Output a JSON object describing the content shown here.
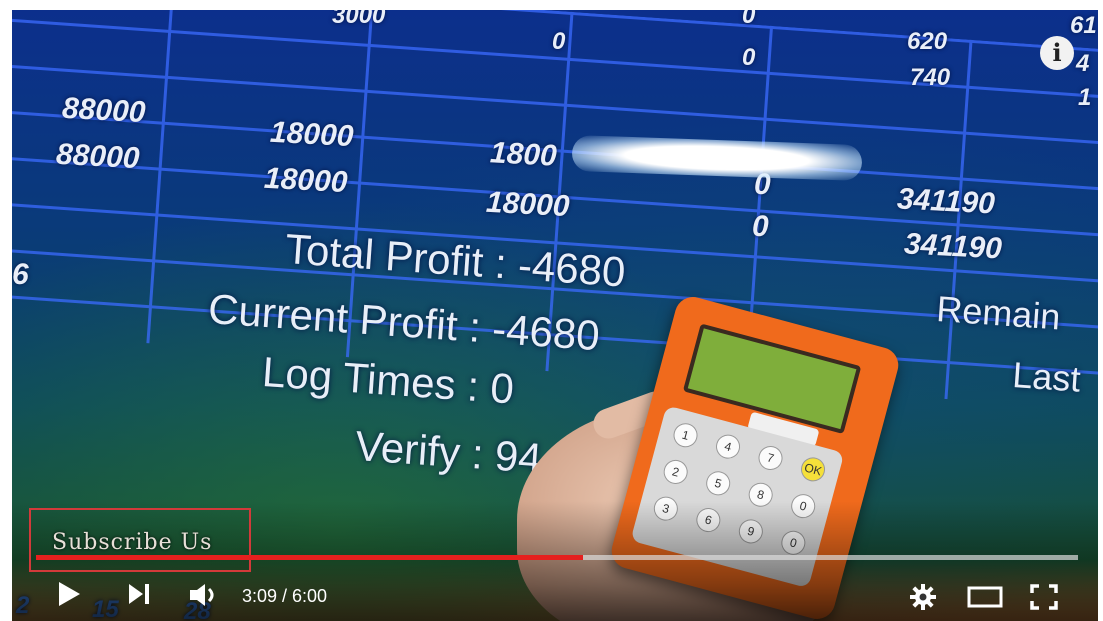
{
  "video": {
    "table_top": {
      "r1": [
        "3000",
        "0",
        "0",
        "620",
        "61"
      ],
      "r2": [
        "0",
        "740",
        "4"
      ],
      "r3": [
        "1"
      ]
    },
    "rows": [
      [
        "88000",
        "18000",
        "1800",
        "",
        "341190"
      ],
      [
        "88000",
        "18000",
        "18000",
        "0",
        "341190"
      ]
    ],
    "extra_zero": "0",
    "left_digit": "6",
    "labels": {
      "total_profit": "Total Profit : -4680",
      "current_profit": "Current Profit : -4680",
      "log_times": "Log Times : 0",
      "verify": "Verify : 94",
      "remain": "Remain",
      "last": "Last"
    },
    "bottom_numbers": [
      "2",
      "15",
      "28"
    ],
    "keypad_keys": [
      "1",
      "2",
      "3",
      "4",
      "5",
      "6",
      "7",
      "8",
      "9",
      "0",
      "0",
      "OK"
    ]
  },
  "overlay": {
    "subscribe_text": "Subscribe Us",
    "info_icon": "i"
  },
  "player": {
    "current_time": "3:09",
    "duration": "6:00",
    "time_display": "3:09 / 6:00",
    "progress_fraction": 0.525,
    "colors": {
      "progress": "#e5201e",
      "overlay_box": "#d23a3a"
    },
    "icons": [
      "play-icon",
      "next-icon",
      "volume-icon",
      "settings-icon",
      "theater-icon",
      "fullscreen-icon",
      "info-icon"
    ]
  }
}
